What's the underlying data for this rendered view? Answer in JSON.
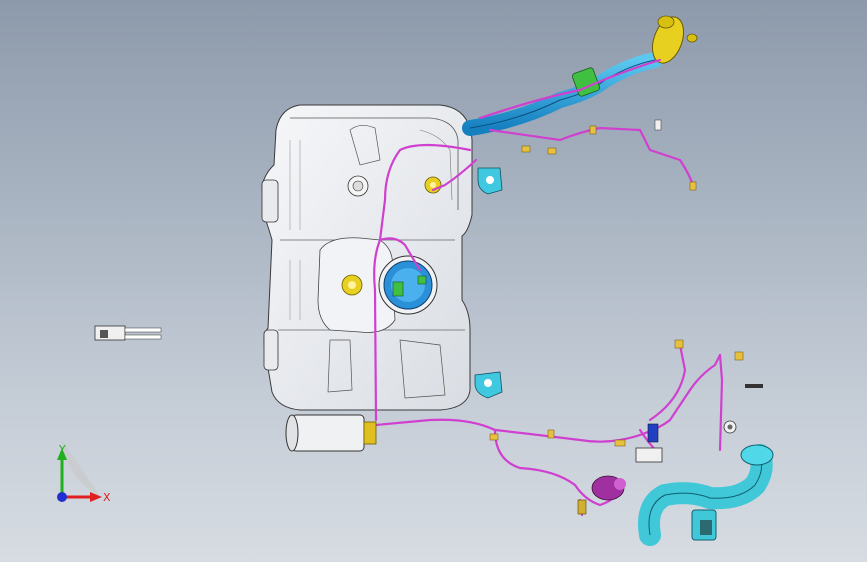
{
  "viewport": {
    "title": "",
    "background_top": "#8d9aab",
    "background_bottom": "#d7dce2"
  },
  "triad": {
    "x_label": "X",
    "y_label": "Y",
    "x_color": "#e02020",
    "y_color": "#20b020",
    "z_color": "#2030d0"
  },
  "model": {
    "tank_color": "#eef0f3",
    "line_color": "#333333",
    "hose_color": "#d040d0",
    "pipe_color": "#1ea8e0",
    "pipe_light_color": "#40d0e0",
    "yellow_part_color": "#e8d020",
    "green_part_color": "#40c040"
  }
}
